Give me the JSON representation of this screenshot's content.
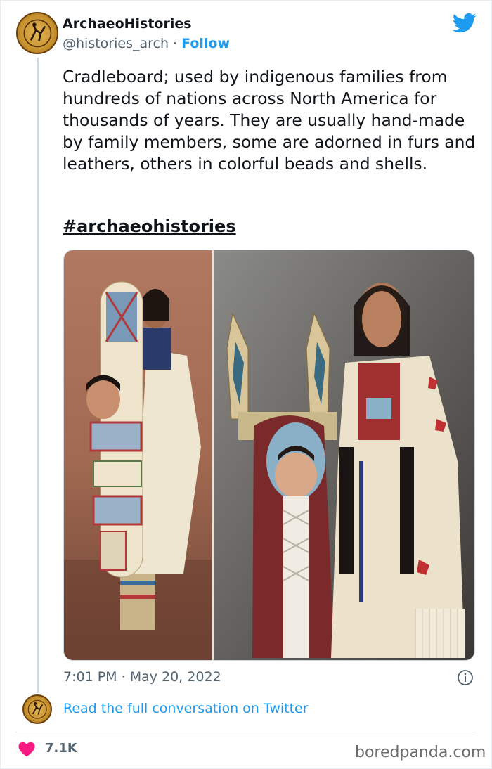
{
  "author": {
    "display_name": "ArchaeoHistories",
    "handle": "@histories_arch",
    "separator": " · ",
    "follow_label": "Follow"
  },
  "tweet": {
    "text": "Cradleboard; used by indigenous families from hundreds of nations across North America for thousands of years. They are usually hand-made by family members, some are adorned in furs and leathers, others in colorful beads and shells.",
    "hashtag": "#archaeohistories",
    "time": "7:01 PM",
    "date_separator": " · ",
    "date": "May 20, 2022"
  },
  "footer": {
    "read_link": "Read the full conversation on Twitter",
    "likes": "7.1K",
    "watermark": "boredpanda.com"
  },
  "icons": {
    "platform": "twitter-bird-icon",
    "info": "info-icon",
    "like": "heart-icon"
  },
  "colors": {
    "link": "#1d9bf0",
    "heart": "#f91880",
    "secondary_text": "#536471"
  }
}
